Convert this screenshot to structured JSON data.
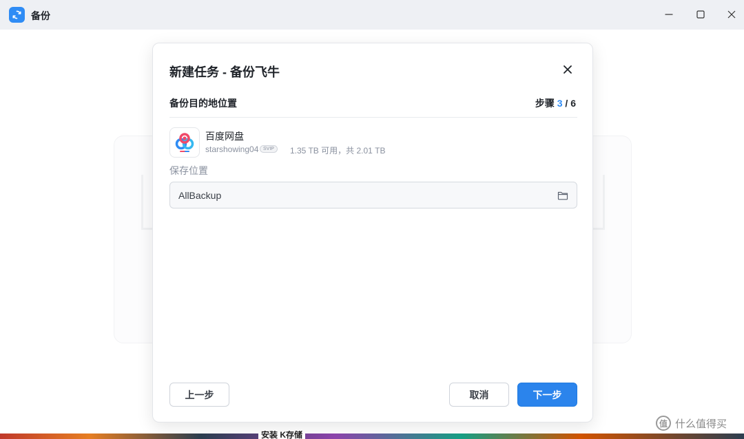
{
  "window": {
    "title": "备份",
    "app_icon": "backup-sync-icon",
    "controls": [
      "minimize-icon",
      "maximize-icon",
      "close-icon"
    ]
  },
  "modal": {
    "title": "新建任务 - 备份飞牛",
    "section_label": "备份目的地位置",
    "step_label": "步骤",
    "step_current": "3",
    "step_separator": " / ",
    "step_total": "6",
    "destination": {
      "name": "百度网盘",
      "account": "starshowing04",
      "badge": "SVIP",
      "capacity": "1.35 TB 可用，共 2.01 TB",
      "logo_icon": "baidu-netdisk-logo"
    },
    "save_location": {
      "label": "保存位置",
      "value": "AllBackup",
      "browse_icon": "folder-icon"
    },
    "buttons": {
      "prev": "上一步",
      "cancel": "取消",
      "next": "下一步"
    }
  },
  "background": {
    "task_label": "安装 K存储",
    "watermark": "什么值得买",
    "watermark_badge": "值"
  },
  "colors": {
    "accent": "#2f8cf5",
    "primary_button": "#2b84ec"
  }
}
